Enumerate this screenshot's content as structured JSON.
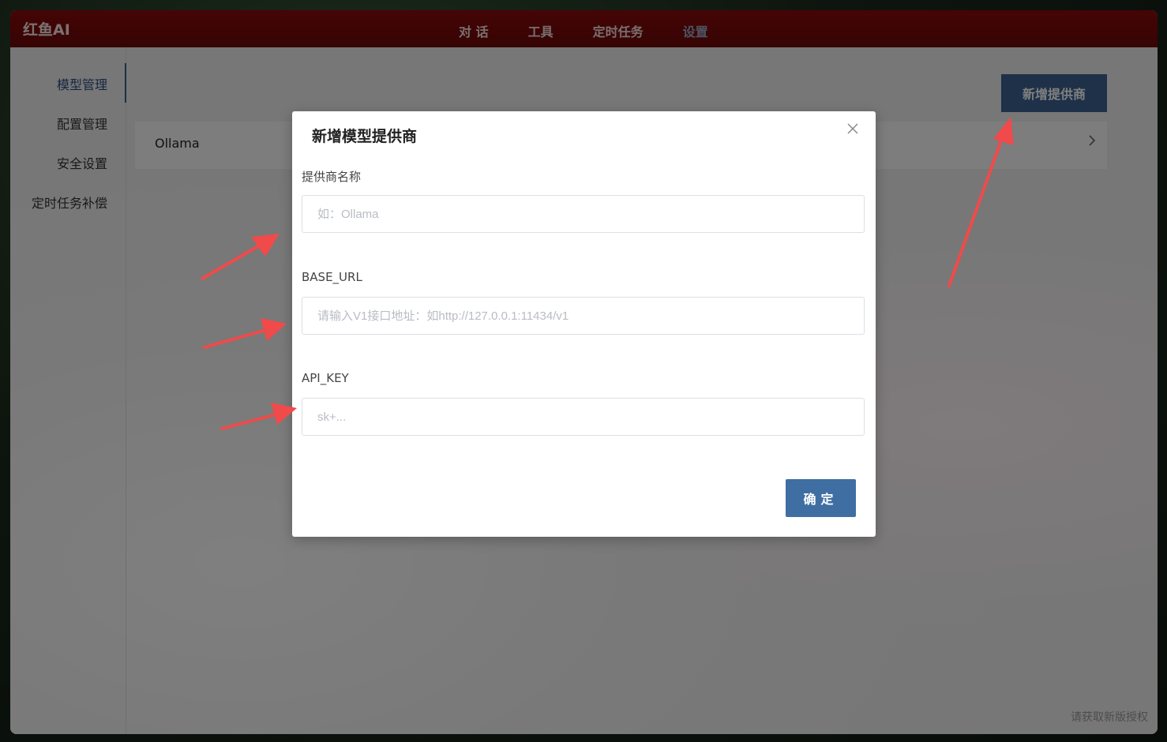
{
  "app": {
    "brand": "红鱼AI"
  },
  "nav": {
    "items": [
      {
        "label": "对 话"
      },
      {
        "label": "工具"
      },
      {
        "label": "定时任务"
      },
      {
        "label": "设置"
      }
    ],
    "active": "设置"
  },
  "sidebar": {
    "items": [
      {
        "label": "模型管理"
      },
      {
        "label": "配置管理"
      },
      {
        "label": "安全设置"
      },
      {
        "label": "定时任务补偿"
      }
    ],
    "active": "模型管理"
  },
  "main": {
    "add_provider_label": "新增提供商",
    "providers": [
      {
        "name": "Ollama"
      }
    ]
  },
  "footer": {
    "license_link": "请获取新版授权"
  },
  "modal": {
    "title": "新增模型提供商",
    "close_icon": "×",
    "fields": {
      "name": {
        "label": "提供商名称",
        "placeholder": "如：Ollama",
        "value": ""
      },
      "base_url": {
        "label": "BASE_URL",
        "placeholder": "请输入V1接口地址：如http://127.0.0.1:11434/v1",
        "value": ""
      },
      "api_key": {
        "label": "API_KEY",
        "placeholder": "sk+...",
        "value": ""
      }
    },
    "confirm_label": "确定"
  },
  "colors": {
    "topbar": "#7a0909",
    "accent": "#3d6393",
    "annotation_arrow": "#f04a4a"
  },
  "icons": {
    "chevron": "chevron-right-icon",
    "close": "close-icon"
  }
}
